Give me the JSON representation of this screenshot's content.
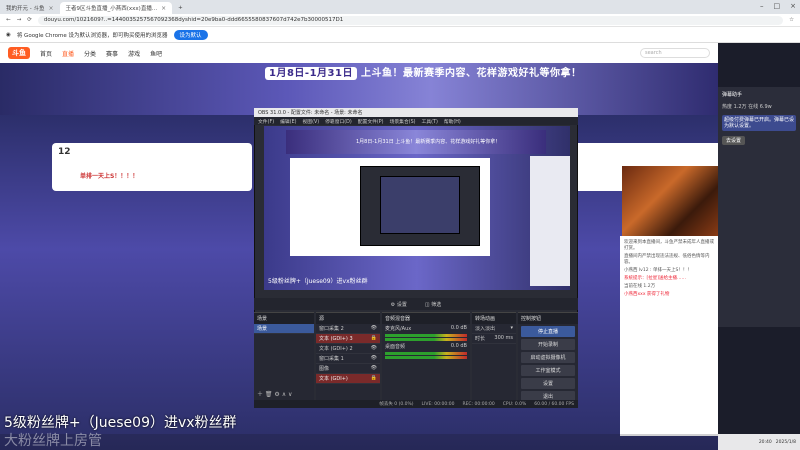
{
  "browser": {
    "tabs": [
      {
        "label": "我的开元 - 斗鱼",
        "active": false
      },
      {
        "label": "王者9区斗鱼直播_小燕西(xxx)直播...",
        "active": true
      }
    ],
    "address": "douyu.com/1021609?..=1440035257567092368dyshid=20e9ba0-ddd6655580837607d742e7b30000517D1",
    "notice_text": "将 Google Chrome 设为默认浏览器，即可购买使用的浏览器",
    "notice_button": "设为默认"
  },
  "site": {
    "logo": "斗鱼",
    "nav": [
      "首页",
      "直播",
      "分类",
      "赛事",
      "游戏",
      "鱼吧"
    ],
    "active_nav": "直播",
    "search_placeholder": "search",
    "banner_date": "1月8日-1月31日",
    "banner_slogan": "上斗鱼！最新赛季内容、花样游戏好礼等你拿！",
    "streamer_title": "单排一天上S！！！！",
    "level": "12"
  },
  "obs": {
    "title": "OBS 31.0.0 - 配置文件: 未命名 - 场景: 未命名",
    "menu": [
      "文件(F)",
      "编辑(E)",
      "视图(V)",
      "停靠窗口(D)",
      "配置文件(P)",
      "场景集合(S)",
      "工具(T)",
      "帮助(H)"
    ],
    "preview_banner": "1月8日-1月31日 上斗鱼！最新赛季内容、花样游戏好礼等你拿！",
    "preview_caption": "5级粉丝牌+（Juese09）进vx粉丝群",
    "controls_row": [
      "设置",
      "筛选"
    ],
    "docks": {
      "scenes": {
        "title": "场景",
        "items": [
          "场景"
        ]
      },
      "sources": {
        "title": "源",
        "items": [
          "窗口采集 2",
          "文本 (GDI+) 3",
          "文本 (GDI+) 2",
          "窗口采集 1",
          "图像",
          "文本 (GDI+)"
        ]
      },
      "mixer": {
        "title": "音频混音器",
        "channels": [
          {
            "name": "麦克风/Aux",
            "db": "0.0 dB"
          },
          {
            "name": "桌面音频",
            "db": "0.0 dB"
          }
        ]
      },
      "transitions": {
        "title": "转场动画",
        "type": "淡入淡出",
        "duration_label": "时长",
        "duration": "300 ms"
      },
      "controls": {
        "title": "控制按钮",
        "buttons": [
          "停止直播",
          "开始录制",
          "启动虚拟摄像机",
          "工作室模式",
          "设置",
          "退出"
        ]
      }
    },
    "status": [
      "帧丢失 0 (0.0%)",
      "LIVE: 00:00:00",
      "REC: 00:00:00",
      "CPU: 0.0%",
      "60.00 / 60.00 FPS"
    ]
  },
  "chat": {
    "lines": [
      "欢迎来到本直播间，斗鱼严禁未成年人直播或打赏。",
      "直播间内严禁出现违法违规、低俗色情等内容。",
      "小燕西 lv12 : 单排一天上S！！！",
      "系统提示：[拉星]送给主播……",
      "当前在线 1.2万"
    ],
    "gift_highlight": "小燕西xxx 获得了礼物"
  },
  "sidepanel": {
    "header": "弹幕助手",
    "stats": [
      "热度 1.2万",
      "人气 42",
      "礼物 42",
      "在线 6.9w"
    ],
    "notice": "超级付费弹幕已开启。弹幕已设为默认设置。",
    "button": "去设置"
  },
  "overlay": {
    "line1": "5级粉丝牌+（Juese09）进vx粉丝群",
    "line2": "大粉丝牌上房管"
  },
  "taskbar": {
    "time": "20:40",
    "date": "2025/1/8"
  },
  "colors": {
    "brand": "#ff5d23",
    "obs_bg": "#2a2c35",
    "obs_accent": "#3b5a9c"
  }
}
